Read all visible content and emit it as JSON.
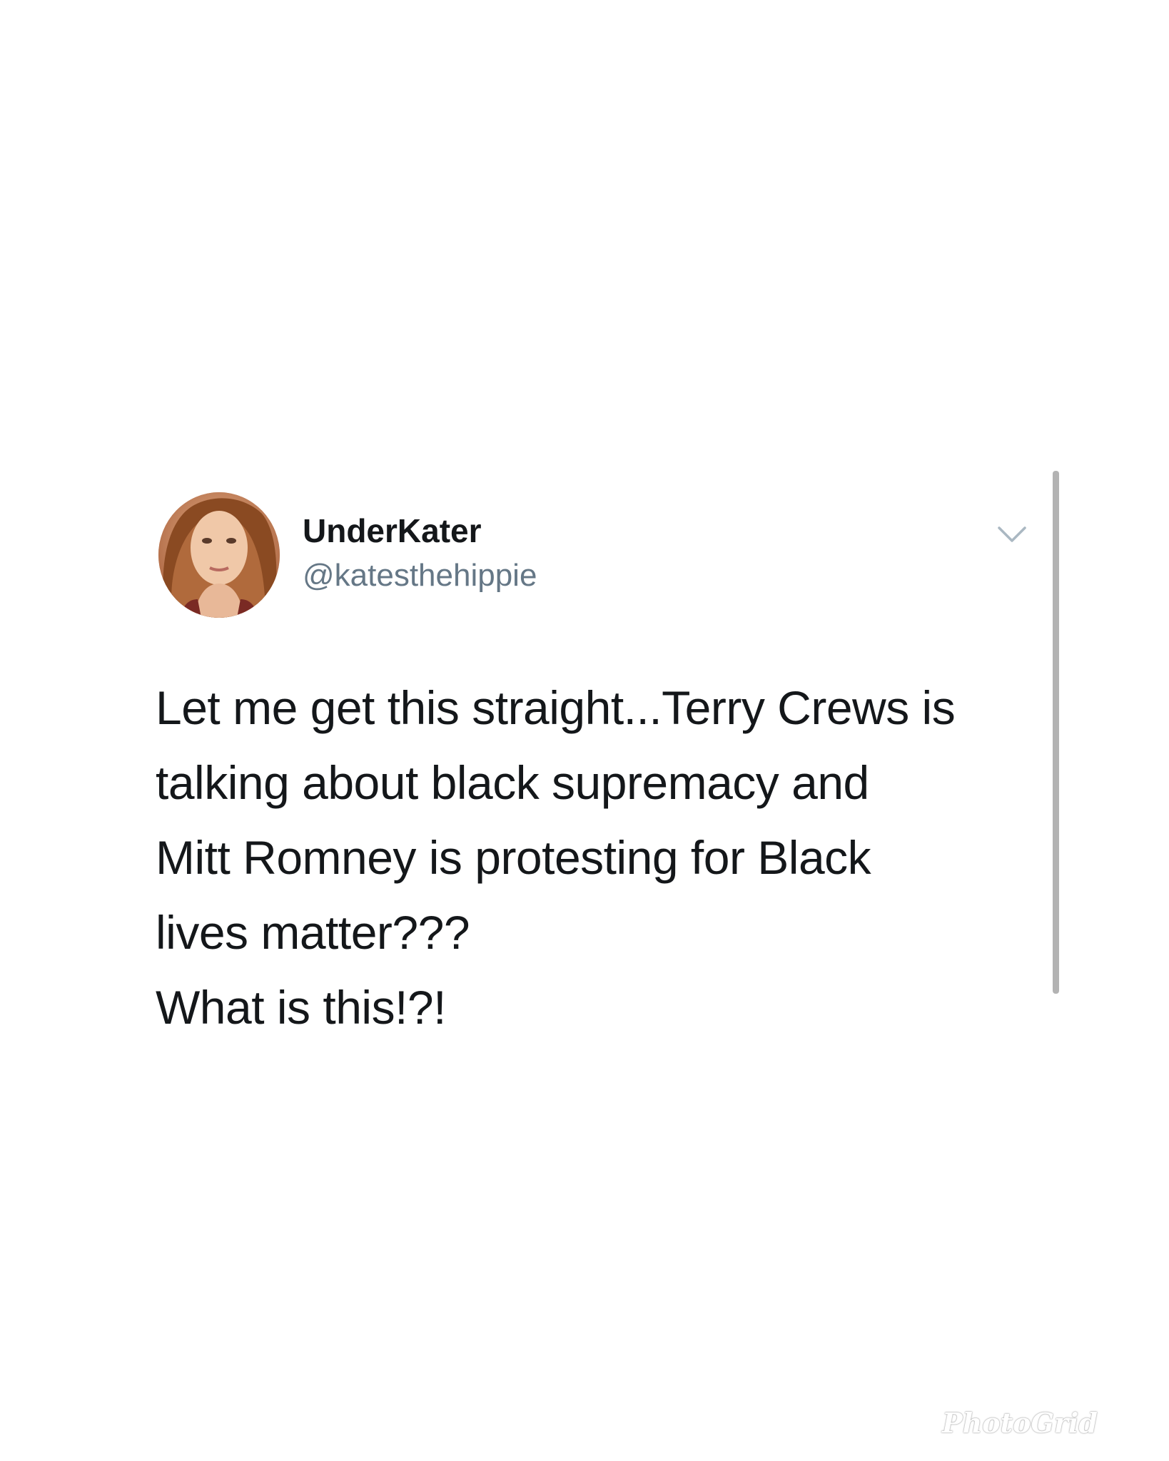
{
  "tweet": {
    "display_name": "UnderKater",
    "handle": "@katesthehippie",
    "text_lines": [
      "Let me get this straight...Terry Crews is",
      "talking about black supremacy and",
      "Mitt Romney is protesting for Black",
      "lives matter???",
      "What is this!?!"
    ],
    "menu_icon": "chevron-down-icon"
  },
  "watermark": {
    "text": "PhotoGrid"
  },
  "colors": {
    "background": "#ffffff",
    "name": "#14171a",
    "handle": "#657786",
    "chevron": "#aab8c2",
    "scrollbar": "#b3b3b3"
  }
}
